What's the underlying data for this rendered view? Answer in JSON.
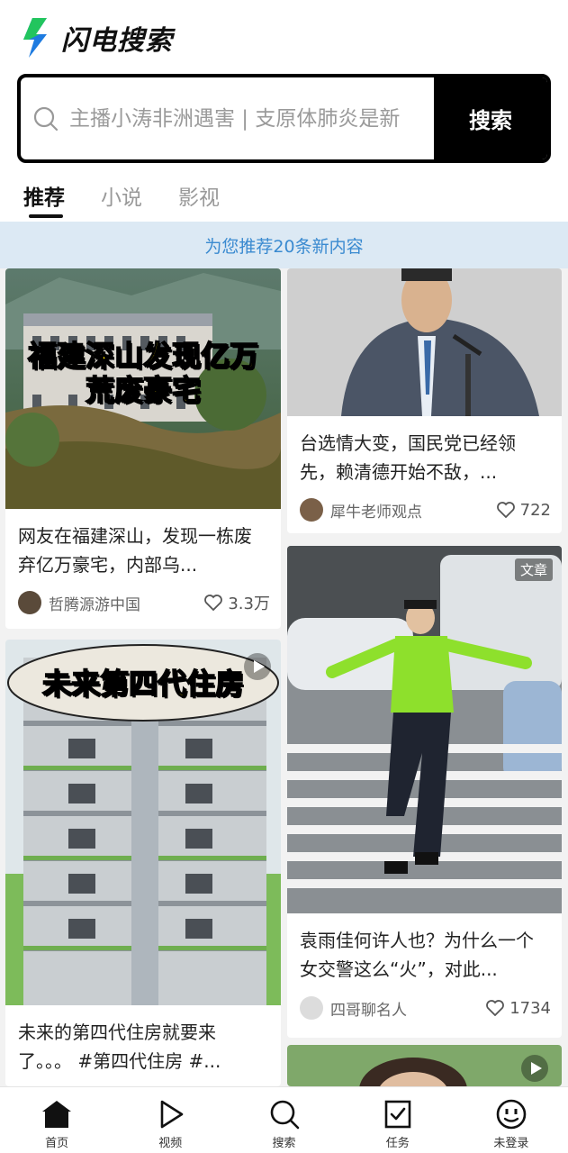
{
  "app": {
    "name": "闪电搜索"
  },
  "search": {
    "placeholder": "主播小涛非洲遇害 | 支原体肺炎是新",
    "button_label": "搜索"
  },
  "tabs": [
    {
      "label": "推荐",
      "active": true
    },
    {
      "label": "小说",
      "active": false
    },
    {
      "label": "影视",
      "active": false
    }
  ],
  "notice": "为您推荐20条新内容",
  "feed": {
    "left": [
      {
        "thumb_caption_line1": "福建深山发现亿万",
        "thumb_caption_line2": "荒废豪宅",
        "title": "网友在福建深山，发现一栋废弃亿万豪宅，内部乌...",
        "author": "哲腾源游中国",
        "likes": "3.3万"
      },
      {
        "thumb_caption_line1": "未来第四代住房",
        "title": "未来的第四代住房就要来了。。。 #第四代住房 #...",
        "has_play": true
      }
    ],
    "right": [
      {
        "title": "台选情大变，国民党已经领先，赖清德开始不敌，...",
        "author": "犀牛老师观点",
        "likes": "722"
      },
      {
        "badge": "文章",
        "title": "袁雨佳何许人也？为什么一个女交警这么“火”，对此...",
        "author": "四哥聊名人",
        "likes": "1734"
      },
      {
        "has_play": true
      }
    ]
  },
  "bottom_nav": [
    {
      "label": "首页",
      "icon": "home-icon",
      "active": true
    },
    {
      "label": "视频",
      "icon": "video-play-icon",
      "active": false
    },
    {
      "label": "搜索",
      "icon": "search-icon",
      "active": false
    },
    {
      "label": "任务",
      "icon": "task-check-icon",
      "active": false
    },
    {
      "label": "未登录",
      "icon": "smiley-face-icon",
      "active": false
    }
  ],
  "colors": {
    "accent_blue": "#3a8ad0",
    "notice_bg": "#dce9f4",
    "brand_green": "#22c55e",
    "brand_blue": "#1e7be0"
  }
}
